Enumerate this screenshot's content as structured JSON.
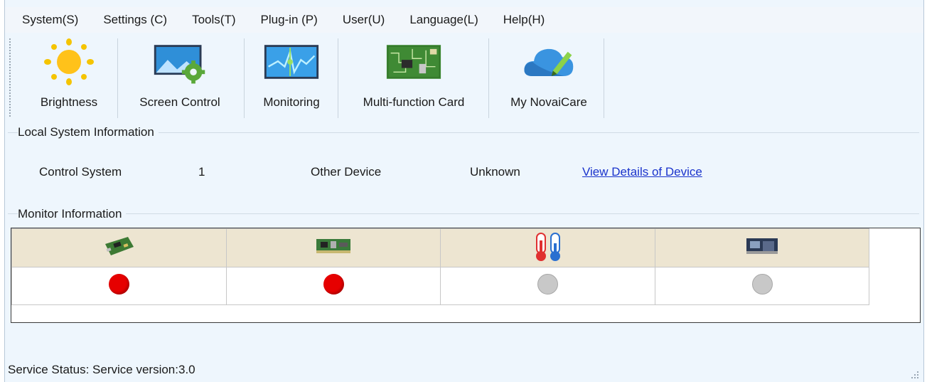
{
  "menu": [
    "System(S)",
    "Settings (C)",
    "Tools(T)",
    "Plug-in (P)",
    "User(U)",
    "Language(L)",
    "Help(H)"
  ],
  "toolbar": {
    "brightness": {
      "label": "Brightness",
      "icon": "sun-icon"
    },
    "screen_control": {
      "label": "Screen Control",
      "icon": "screen-gear-icon"
    },
    "monitoring": {
      "label": "Monitoring",
      "icon": "monitor-waveform-icon"
    },
    "multifunction": {
      "label": "Multi-function Card",
      "icon": "circuit-board-icon"
    },
    "novaicare": {
      "label": "My NovaiCare",
      "icon": "cloud-pen-icon"
    }
  },
  "local_info": {
    "title": "Local System Information",
    "control_system_label": "Control System",
    "control_system_value": "1",
    "other_device_label": "Other Device",
    "other_device_value": "Unknown",
    "details_link": "View Details of Device"
  },
  "monitor": {
    "title": "Monitor Information",
    "columns": [
      {
        "icon": "receiving-card-icon",
        "status": "red"
      },
      {
        "icon": "sending-card-icon",
        "status": "red"
      },
      {
        "icon": "thermometer-icon",
        "status": "gray"
      },
      {
        "icon": "chip-card-icon",
        "status": "gray"
      }
    ]
  },
  "status_bar": {
    "text": "Service Status:  Service version:3.0"
  },
  "colors": {
    "red": "#e60000",
    "gray": "#c8c8c8",
    "link": "#1a33cc",
    "header": "#ede5d1"
  }
}
